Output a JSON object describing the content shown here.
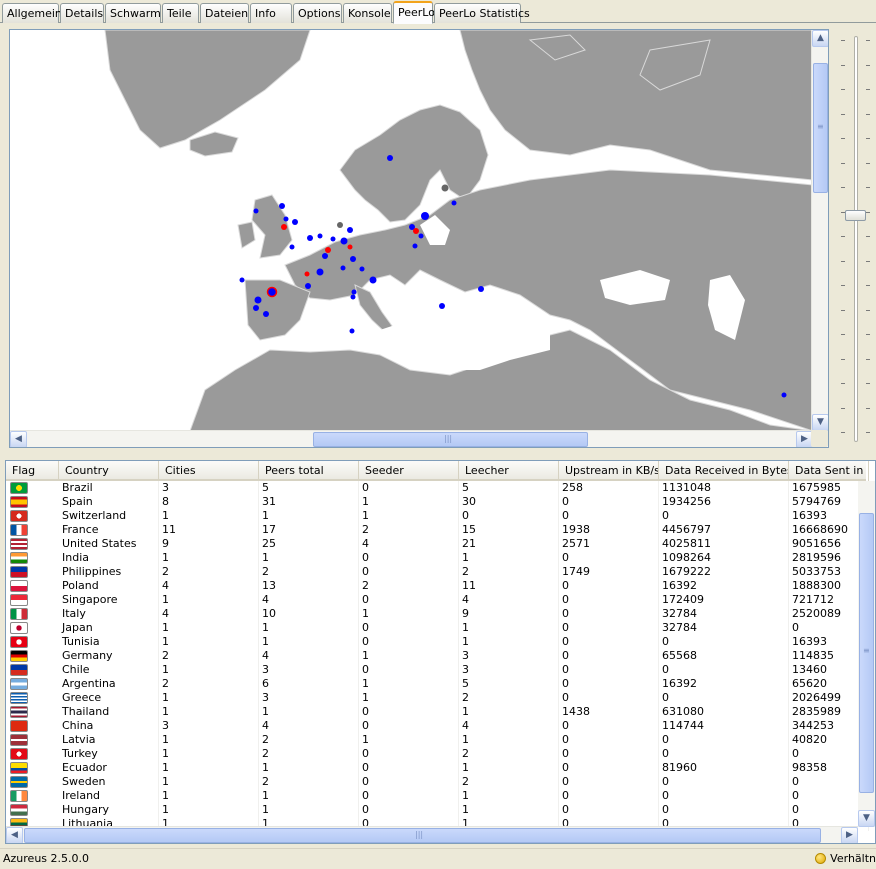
{
  "tabs": [
    "Allgemein",
    "Details",
    "Schwarm",
    "Teile",
    "Dateien",
    "Info",
    "Options",
    "Konsole",
    "PeerLo",
    "PeerLo Statistics"
  ],
  "active_tab": "PeerLo",
  "colors": {
    "land": "#9a9a9a",
    "sea": "#ffffff",
    "peer_marker": "#0000ff",
    "seed_marker": "#ff0000",
    "highlight_tab": "#f2a31c"
  },
  "table": {
    "columns": [
      "Flag",
      "Country",
      "Cities",
      "Peers total",
      "Seeder",
      "Leecher",
      "Upstream in KB/s",
      "Data Received in Bytes",
      "Data Sent in"
    ],
    "rows": [
      {
        "flag": "brazil-flag",
        "country": "Brazil",
        "cities": "3",
        "peers": "5",
        "seeder": "0",
        "leecher": "5",
        "up": "258",
        "recv": "1131048",
        "sent": "1675985"
      },
      {
        "flag": "spain-flag",
        "country": "Spain",
        "cities": "8",
        "peers": "31",
        "seeder": "1",
        "leecher": "30",
        "up": "0",
        "recv": "1934256",
        "sent": "5794769"
      },
      {
        "flag": "switzerland-flag",
        "country": "Switzerland",
        "cities": "1",
        "peers": "1",
        "seeder": "1",
        "leecher": "0",
        "up": "0",
        "recv": "0",
        "sent": "16393"
      },
      {
        "flag": "france-flag",
        "country": "France",
        "cities": "11",
        "peers": "17",
        "seeder": "2",
        "leecher": "15",
        "up": "1938",
        "recv": "4456797",
        "sent": "16668690"
      },
      {
        "flag": "usa-flag",
        "country": "United States",
        "cities": "9",
        "peers": "25",
        "seeder": "4",
        "leecher": "21",
        "up": "2571",
        "recv": "4025811",
        "sent": "9051656"
      },
      {
        "flag": "india-flag",
        "country": "India",
        "cities": "1",
        "peers": "1",
        "seeder": "0",
        "leecher": "1",
        "up": "0",
        "recv": "1098264",
        "sent": "2819596"
      },
      {
        "flag": "philippines-flag",
        "country": "Philippines",
        "cities": "2",
        "peers": "2",
        "seeder": "0",
        "leecher": "2",
        "up": "1749",
        "recv": "1679222",
        "sent": "5033753"
      },
      {
        "flag": "poland-flag",
        "country": "Poland",
        "cities": "4",
        "peers": "13",
        "seeder": "2",
        "leecher": "11",
        "up": "0",
        "recv": "16392",
        "sent": "1888300"
      },
      {
        "flag": "singapore-flag",
        "country": "Singapore",
        "cities": "1",
        "peers": "4",
        "seeder": "0",
        "leecher": "4",
        "up": "0",
        "recv": "172409",
        "sent": "721712"
      },
      {
        "flag": "italy-flag",
        "country": "Italy",
        "cities": "4",
        "peers": "10",
        "seeder": "1",
        "leecher": "9",
        "up": "0",
        "recv": "32784",
        "sent": "2520089"
      },
      {
        "flag": "japan-flag",
        "country": "Japan",
        "cities": "1",
        "peers": "1",
        "seeder": "0",
        "leecher": "1",
        "up": "0",
        "recv": "32784",
        "sent": "0"
      },
      {
        "flag": "tunisia-flag",
        "country": "Tunisia",
        "cities": "1",
        "peers": "1",
        "seeder": "0",
        "leecher": "1",
        "up": "0",
        "recv": "0",
        "sent": "16393"
      },
      {
        "flag": "germany-flag",
        "country": "Germany",
        "cities": "2",
        "peers": "4",
        "seeder": "1",
        "leecher": "3",
        "up": "0",
        "recv": "65568",
        "sent": "114835"
      },
      {
        "flag": "chile-flag",
        "country": "Chile",
        "cities": "1",
        "peers": "3",
        "seeder": "0",
        "leecher": "3",
        "up": "0",
        "recv": "0",
        "sent": "13460"
      },
      {
        "flag": "argentina-flag",
        "country": "Argentina",
        "cities": "2",
        "peers": "6",
        "seeder": "1",
        "leecher": "5",
        "up": "0",
        "recv": "16392",
        "sent": "65620"
      },
      {
        "flag": "greece-flag",
        "country": "Greece",
        "cities": "1",
        "peers": "3",
        "seeder": "1",
        "leecher": "2",
        "up": "0",
        "recv": "0",
        "sent": "2026499"
      },
      {
        "flag": "thailand-flag",
        "country": "Thailand",
        "cities": "1",
        "peers": "1",
        "seeder": "0",
        "leecher": "1",
        "up": "1438",
        "recv": "631080",
        "sent": "2835989"
      },
      {
        "flag": "china-flag",
        "country": "China",
        "cities": "3",
        "peers": "4",
        "seeder": "0",
        "leecher": "4",
        "up": "0",
        "recv": "114744",
        "sent": "344253"
      },
      {
        "flag": "latvia-flag",
        "country": "Latvia",
        "cities": "1",
        "peers": "2",
        "seeder": "1",
        "leecher": "1",
        "up": "0",
        "recv": "0",
        "sent": "40820"
      },
      {
        "flag": "turkey-flag",
        "country": "Turkey",
        "cities": "1",
        "peers": "2",
        "seeder": "0",
        "leecher": "2",
        "up": "0",
        "recv": "0",
        "sent": "0"
      },
      {
        "flag": "ecuador-flag",
        "country": "Ecuador",
        "cities": "1",
        "peers": "1",
        "seeder": "0",
        "leecher": "1",
        "up": "0",
        "recv": "81960",
        "sent": "98358"
      },
      {
        "flag": "sweden-flag",
        "country": "Sweden",
        "cities": "1",
        "peers": "2",
        "seeder": "0",
        "leecher": "2",
        "up": "0",
        "recv": "0",
        "sent": "0"
      },
      {
        "flag": "ireland-flag",
        "country": "Ireland",
        "cities": "1",
        "peers": "1",
        "seeder": "0",
        "leecher": "1",
        "up": "0",
        "recv": "0",
        "sent": "0"
      },
      {
        "flag": "hungary-flag",
        "country": "Hungary",
        "cities": "1",
        "peers": "1",
        "seeder": "0",
        "leecher": "1",
        "up": "0",
        "recv": "0",
        "sent": "0"
      },
      {
        "flag": "lithuania-flag",
        "country": "Lithuania",
        "cities": "1",
        "peers": "1",
        "seeder": "0",
        "leecher": "1",
        "up": "0",
        "recv": "0",
        "sent": "0"
      }
    ]
  },
  "status": {
    "version": "Azureus 2.5.0.0",
    "right_text": "Verhältn"
  }
}
